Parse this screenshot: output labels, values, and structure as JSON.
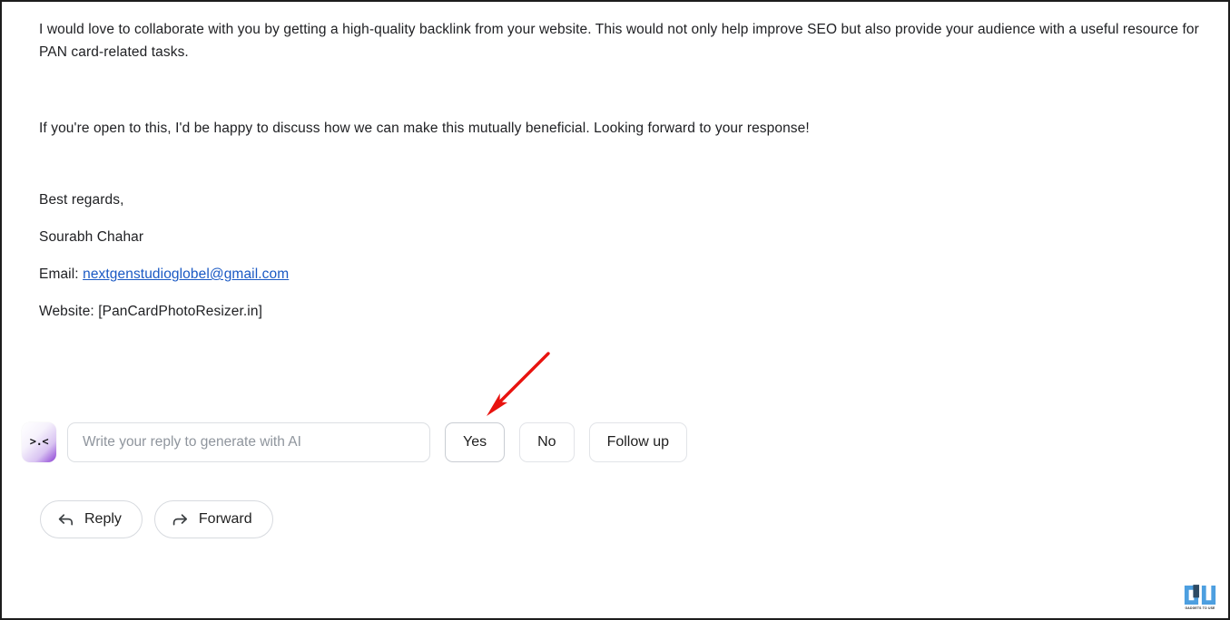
{
  "email": {
    "paragraphs": [
      "I would love to collaborate with you by getting a high-quality backlink from your website. This would not only help improve SEO but also provide your audience with a useful resource for PAN card-related tasks.",
      "If you're open to this, I'd be happy to discuss how we can make this mutually beneficial. Looking forward to your response!"
    ],
    "signature": {
      "closing": "Best regards,",
      "name": "Sourabh Chahar",
      "email_label": "Email:",
      "email_address": "nextgenstudioglobel@gmail.com",
      "website_line": "Website: [PanCardPhotoResizer.in]"
    }
  },
  "ai_reply_bar": {
    "icon_name": "ai-face-icon",
    "icon_glyph": ">.<",
    "input_value": "",
    "input_placeholder": "Write your reply to generate with AI",
    "suggestions": [
      {
        "label": "Yes",
        "highlighted": true
      },
      {
        "label": "No",
        "highlighted": false
      },
      {
        "label": "Follow up",
        "highlighted": false
      }
    ]
  },
  "actions": [
    {
      "label": "Reply",
      "icon": "reply-arrow-icon"
    },
    {
      "label": "Forward",
      "icon": "forward-arrow-icon"
    }
  ],
  "annotation": {
    "type": "arrow",
    "color": "#e8130f",
    "points_to": "Yes"
  },
  "watermark": {
    "text": "GADGETS TO USE",
    "color": "#4d9fe0"
  },
  "colors": {
    "text": "#202124",
    "link": "#1a59c4",
    "border": "#1c1c1c",
    "placeholder": "#8f959d",
    "accent_purple": "#8b3fd4"
  }
}
